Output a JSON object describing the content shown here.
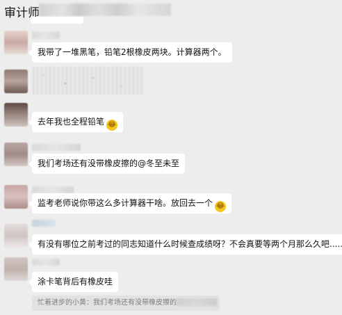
{
  "header": {
    "title": "审计师"
  },
  "messages": [
    {
      "text": "我带了一堆黑笔，铅笔2根橡皮两块。计算器两个。"
    },
    {
      "text": "去年我也全程铅笔",
      "emoji": "laughing-tears-emoji"
    },
    {
      "text": "我们考场还有没带橡皮擦的@冬至未至"
    },
    {
      "text": "监考老师说你带这么多计算器干啥。放回去一个",
      "emoji": "laughing-tears-emoji"
    },
    {
      "text": "有没有哪位之前考过的同志知道什么时候查成绩呀？不会真要等两个月那么久吧......"
    },
    {
      "text": "涂卡笔背后有橡皮哇"
    }
  ],
  "quote": {
    "text": "忙着进步的小黄：我们考场还有没带橡皮擦的"
  },
  "colors": {
    "background": "#ededed",
    "bubble": "#ffffff",
    "emoji": "#f5c51b"
  }
}
